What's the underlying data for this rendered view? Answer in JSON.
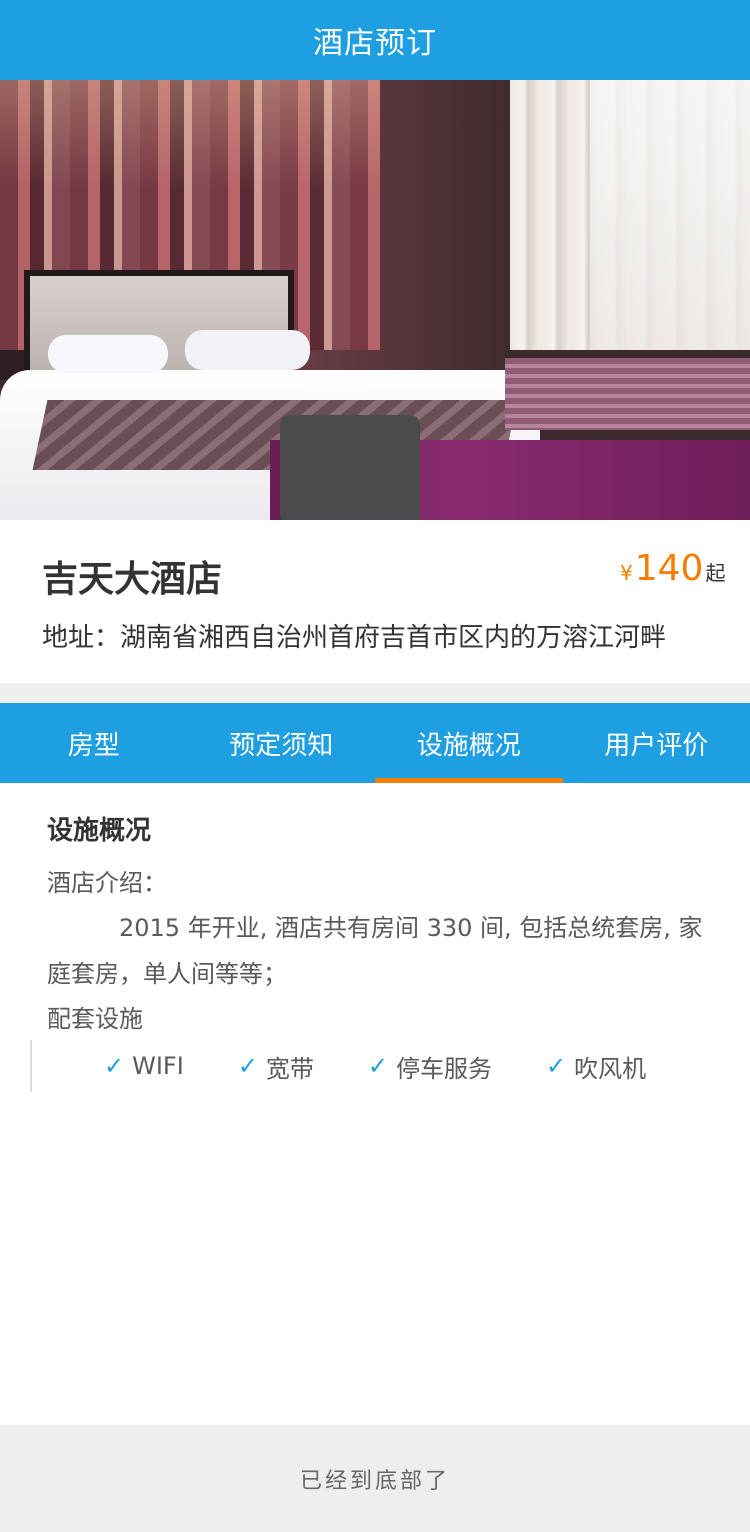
{
  "header": {
    "title": "酒店预订"
  },
  "hero": {
    "image_alt": "hotel-room-photo"
  },
  "hotel": {
    "name": "吉天大酒店",
    "price_currency": "¥",
    "price_value": "140",
    "price_suffix": "起",
    "address": "地址：湖南省湘西自治州首府吉首市区内的万溶江河畔"
  },
  "tabs": [
    {
      "label": "房型",
      "active": false
    },
    {
      "label": "预定须知",
      "active": false
    },
    {
      "label": "设施概况",
      "active": true
    },
    {
      "label": "用户评价",
      "active": false
    }
  ],
  "facilities_section": {
    "title": "设施概况",
    "intro_label": "酒店介绍：",
    "intro_text": "2015 年开业, 酒店共有房间 330 间, 包括总统套房, 家庭套房，单人间等等；",
    "amenities_label": "配套设施",
    "amenities": [
      "WIFI",
      "宽带",
      "停车服务",
      "吹风机"
    ],
    "check_mark": "✓"
  },
  "footer": {
    "text": "已经到底部了"
  },
  "colors": {
    "primary": "#1e9fe1",
    "accent": "#f57d02",
    "text_dark": "#333333",
    "text_body": "#5a5a5a"
  }
}
